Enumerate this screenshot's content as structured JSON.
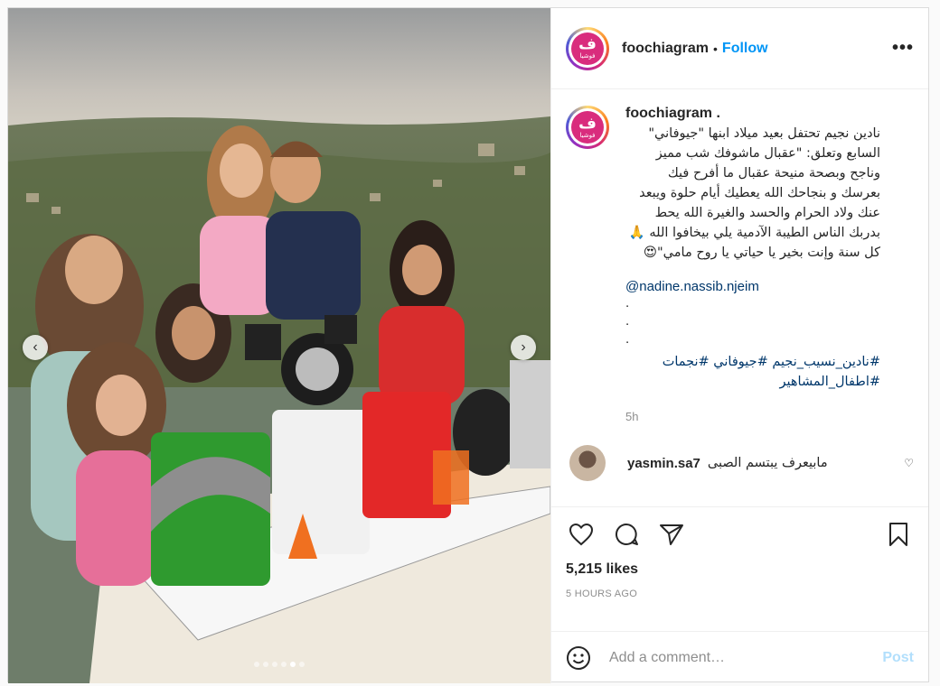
{
  "post": {
    "username": "foochiagram",
    "follow_label": "Follow",
    "separator": "•",
    "more_label": "•••",
    "avatar_logo_glyph": "ف",
    "avatar_logo_text": "فوشيا",
    "colors": {
      "accent": "#0095f6",
      "link": "#00376b",
      "brand": "#d92c7d",
      "post_disabled": "#b2dffc"
    }
  },
  "photo": {
    "carousel_dots": 6,
    "active_dot": 4,
    "prev_icon": "chevron-left-icon",
    "next_icon": "chevron-right-icon"
  },
  "caption": {
    "username": "foochiagram .",
    "text": "نادين نجيم تحتفل بعيد ميلاد ابنها \"جيوفاني\" السابع وتعلق: \"عقبال ماشوفك شب مميز وناجح وبصحة منيحة عقبال ما أفرح فيك بعرسك و بنجاحك الله يعطيك أيام حلوة ويبعد عنك ولاد الحرام والحسد والغيرة الله يحط بدربك الناس الطيبة الآدمية يلي بيخافوا الله 🙏 كل سنة وإنت بخير يا حياتي يا روح مامي\"😍",
    "mention": "@nadine.nassib.njeim",
    "dots": [
      ".",
      ".",
      "."
    ],
    "hashtags": "#نادين_نسيب_نجيم #جيوفاني #نجمات #اطفال_المشاهير",
    "time": "5h"
  },
  "comment": {
    "username": "yasmin.sa7",
    "text": "مابيعرف يبتسم الصبى",
    "heart_icon": "heart-outline-icon"
  },
  "actions": {
    "like_icon": "heart-icon",
    "comment_icon": "comment-icon",
    "share_icon": "paper-plane-icon",
    "save_icon": "bookmark-icon",
    "likes": "5,215 likes",
    "timestamp": "5 HOURS AGO"
  },
  "add_comment": {
    "placeholder": "Add a comment…",
    "post_label": "Post",
    "emoji_icon": "smiley-icon"
  }
}
